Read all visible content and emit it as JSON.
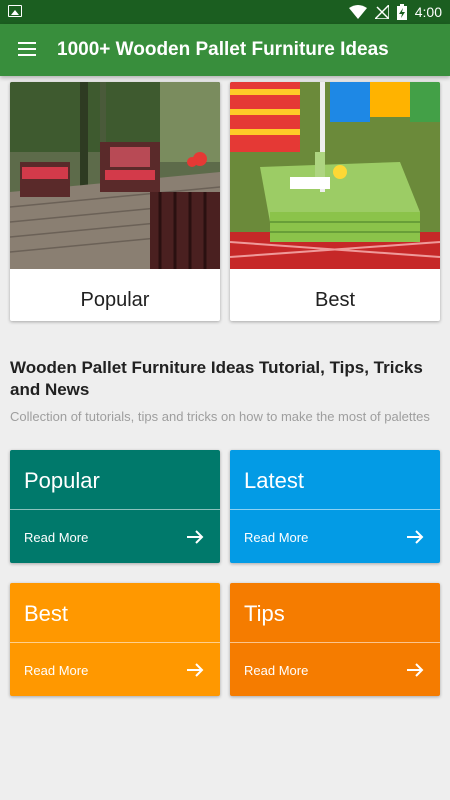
{
  "status_bar": {
    "time": "4:00"
  },
  "app_bar": {
    "title": "1000+ Wooden Pallet Furniture Ideas"
  },
  "feature_cards": [
    {
      "label": "Popular"
    },
    {
      "label": "Best"
    }
  ],
  "section": {
    "title": "Wooden Pallet Furniture Ideas Tutorial, Tips, Tricks and News",
    "subtitle": "Collection of tutorials, tips and tricks on how to make the most of palettes"
  },
  "tiles": [
    {
      "title": "Popular",
      "action": "Read More",
      "color": "#00796b"
    },
    {
      "title": "Latest",
      "action": "Read More",
      "color": "#039be5"
    },
    {
      "title": "Best",
      "action": "Read More",
      "color": "#ff9800"
    },
    {
      "title": "Tips",
      "action": "Read More",
      "color": "#f57c00"
    }
  ],
  "colors": {
    "app_bar": "#388e3c",
    "status_bar": "#1b5e20"
  }
}
